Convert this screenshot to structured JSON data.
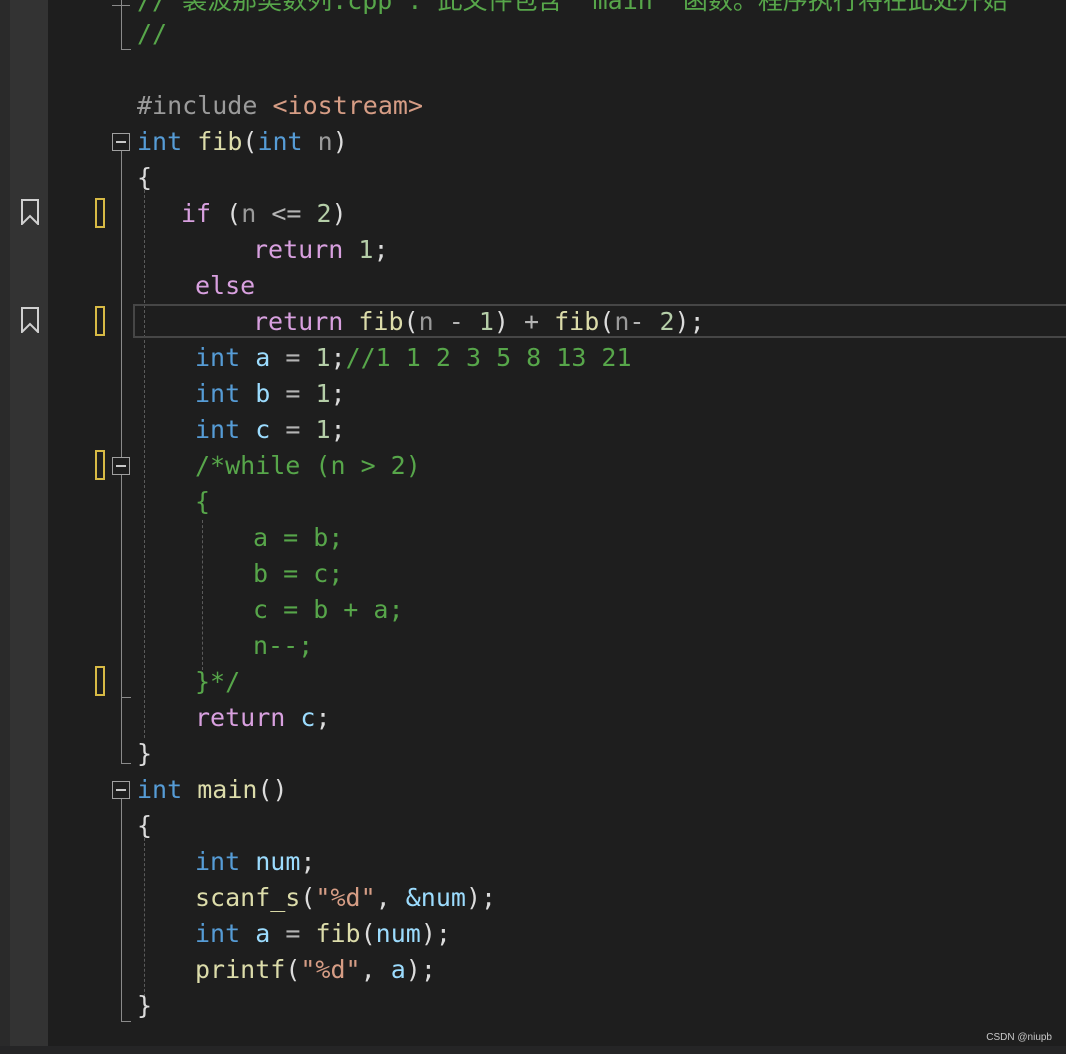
{
  "editor": {
    "line_top": "// 裴波那契数列.cpp : 此文件包含 \"main\" 函数。程序执行将在此处开始",
    "line_comment_empty": "//",
    "include_directive": "#include",
    "include_header": "<iostream>",
    "fib_sig": {
      "ret": "int",
      "name": "fib",
      "ptype": "int",
      "pname": "n"
    },
    "if_line": {
      "kw": "if",
      "open": " (",
      "var": "n",
      "op": " <= ",
      "num": "2",
      "close": ")"
    },
    "return1": {
      "kw": "return",
      "num": "1",
      "semi": ";"
    },
    "else_kw": "else",
    "return_fib": {
      "kw": "return",
      "fn": "fib",
      "a": "n",
      "op1": " - ",
      "n1": "1",
      "plus": " + ",
      "b": "n",
      "op2": "- ",
      "n2": "2"
    },
    "decl_a": {
      "type": "int",
      "name": "a",
      "eq": " = ",
      "val": "1",
      "comment": "//1 1 2 3 5 8 13 21"
    },
    "decl_b": {
      "type": "int",
      "name": "b",
      "eq": " = ",
      "val": "1"
    },
    "decl_c": {
      "type": "int",
      "name": "c",
      "eq": " = ",
      "val": "1"
    },
    "block_comment": [
      "/*while (n > 2)",
      "{",
      "a = b;",
      "b = c;",
      "c = b + a;",
      "n--;",
      "}*/"
    ],
    "return_c": {
      "kw": "return",
      "var": "c"
    },
    "main_sig": {
      "ret": "int",
      "name": "main",
      "parens": "()"
    },
    "decl_num": {
      "type": "int",
      "name": "num"
    },
    "scanf_line": {
      "fn": "scanf_s",
      "fmt": "\"%d\"",
      "arg": "&num"
    },
    "assign_a": {
      "type": "int",
      "name": "a",
      "fn": "fib",
      "arg": "num"
    },
    "printf_line": {
      "fn": "printf",
      "fmt": "\"%d\"",
      "arg": "a"
    },
    "brace_open": "{",
    "brace_close": "}"
  },
  "watermark": "CSDN @niupb",
  "colors": {
    "background": "#1e1e1e",
    "keyword": "#569cd6",
    "control": "#d8a0df",
    "function": "#dcdcaa",
    "variable": "#9cdcfe",
    "number": "#b5cea8",
    "comment": "#57a64a",
    "string": "#d69d85",
    "change_mark": "#d7ba45"
  },
  "icons": [
    "bookmark-icon",
    "collapse-icon"
  ]
}
